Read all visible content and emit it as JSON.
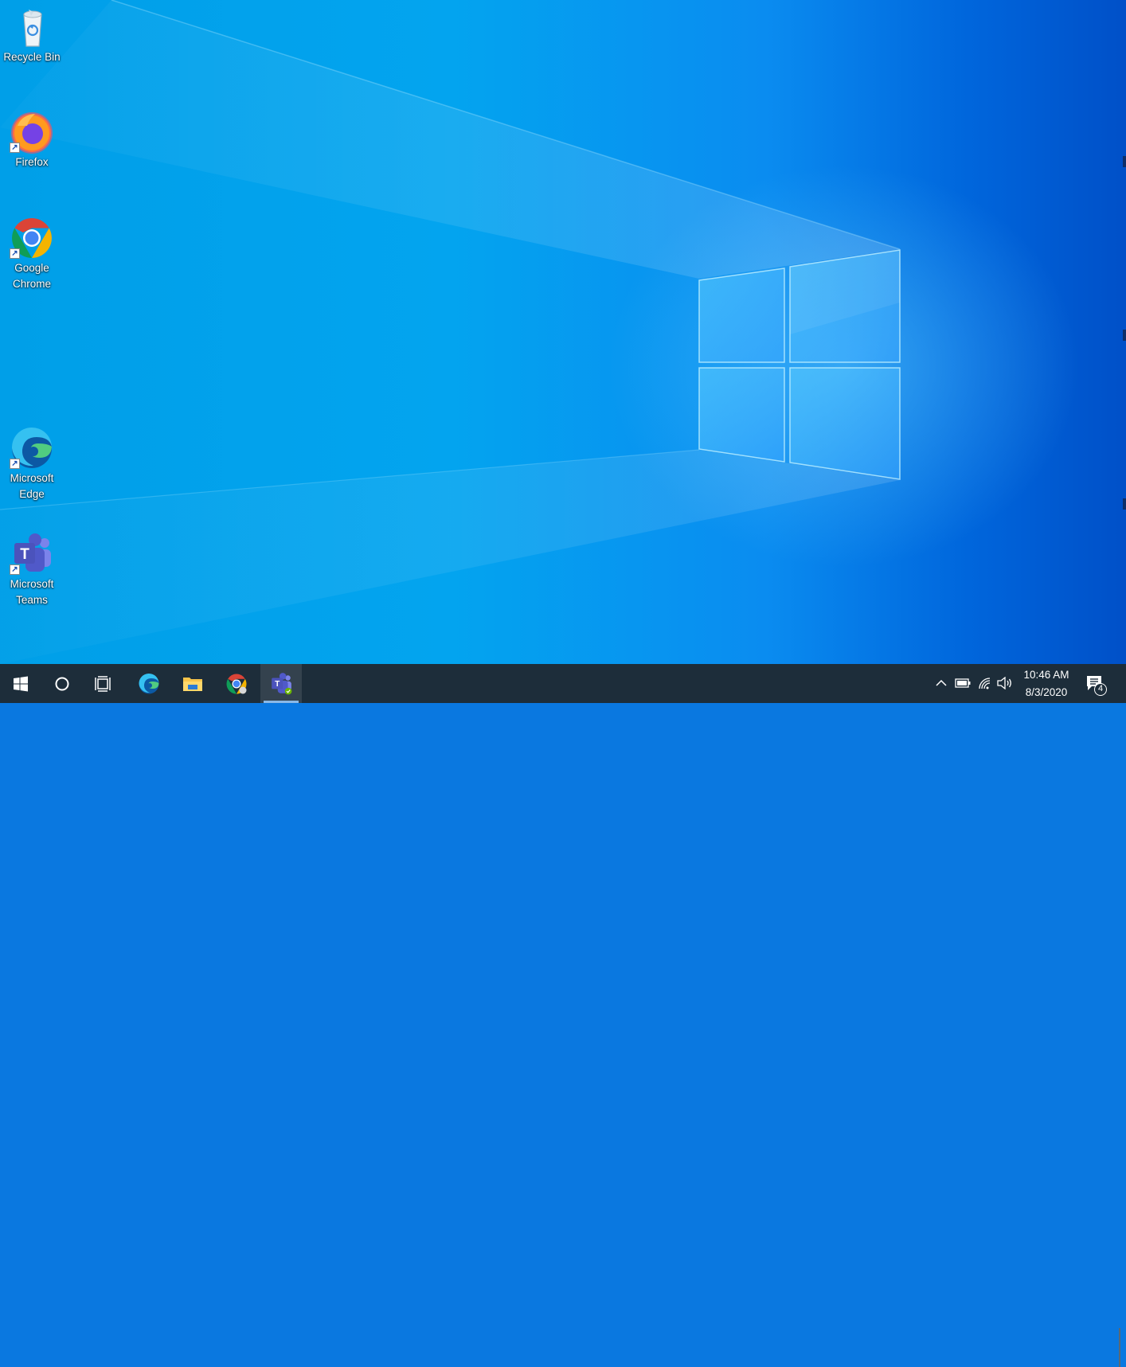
{
  "desktop": {
    "icons": [
      {
        "label": "Recycle Bin",
        "icon": "recycle-bin-icon",
        "shortcut": false
      },
      {
        "label": "Firefox",
        "icon": "firefox-icon",
        "shortcut": true
      },
      {
        "label": "Google Chrome",
        "icon": "chrome-icon",
        "shortcut": true
      },
      {
        "label": "Microsoft Edge",
        "icon": "edge-icon",
        "shortcut": true
      },
      {
        "label": "Microsoft Teams",
        "icon": "teams-icon",
        "shortcut": true
      }
    ],
    "wallpaper": "windows-logo-light"
  },
  "taskbar": {
    "start": "windows-start-icon",
    "search": "cortana-circle-icon",
    "task_view": "task-view-icon",
    "pinned": [
      {
        "name": "Microsoft Edge",
        "icon": "edge-icon",
        "active": false
      },
      {
        "name": "File Explorer",
        "icon": "folder-icon",
        "active": false
      },
      {
        "name": "Google Chrome",
        "icon": "chrome-icon",
        "active": false
      },
      {
        "name": "Microsoft Teams",
        "icon": "teams-icon",
        "active": true
      }
    ],
    "tray": {
      "icons": [
        "chevron-up-icon",
        "battery-icon",
        "wifi-icon",
        "volume-icon"
      ],
      "time": "10:46 AM",
      "date": "8/3/2020",
      "notification_count": "4"
    }
  },
  "colors": {
    "taskbar_bg": "#1d2d3a",
    "desktop_blue": "#009fe8",
    "active_underline": "#8ab8e6"
  }
}
